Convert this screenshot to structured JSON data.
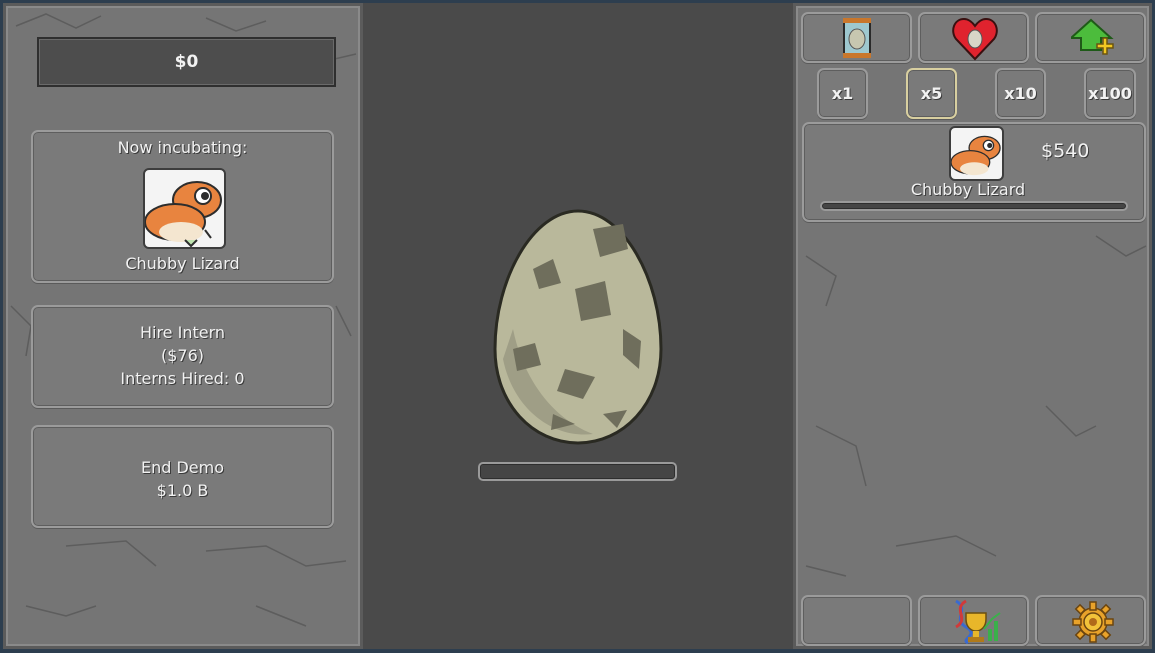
{
  "money": "$0",
  "incubating": {
    "heading": "Now incubating:",
    "creature_name": "Chubby Lizard"
  },
  "hire_intern": {
    "title": "Hire Intern",
    "cost": "($76)",
    "hired": "Interns Hired: 0"
  },
  "end_demo": {
    "title": "End Demo",
    "cost": "$1.0 B"
  },
  "egg": {
    "progress": 0
  },
  "top_buttons": [
    {
      "icon": "egg-jar-icon"
    },
    {
      "icon": "heart-egg-icon"
    },
    {
      "icon": "green-arrow-upgrade-icon"
    }
  ],
  "multipliers": [
    "x1",
    "x5",
    "x10",
    "x100"
  ],
  "selected_multiplier": "x5",
  "shop_item": {
    "price": "$540",
    "name": "Chubby Lizard",
    "progress": 0
  },
  "bottom_buttons": [
    {
      "icon": ""
    },
    {
      "icon": "dna-trophy-stats-icon"
    },
    {
      "icon": "settings-gear-icon"
    }
  ],
  "colors": {
    "stone": "#757575",
    "center_bg": "#4a4a4a",
    "frame": "#2d3e4f",
    "selected_border": "#d8cfa0"
  }
}
